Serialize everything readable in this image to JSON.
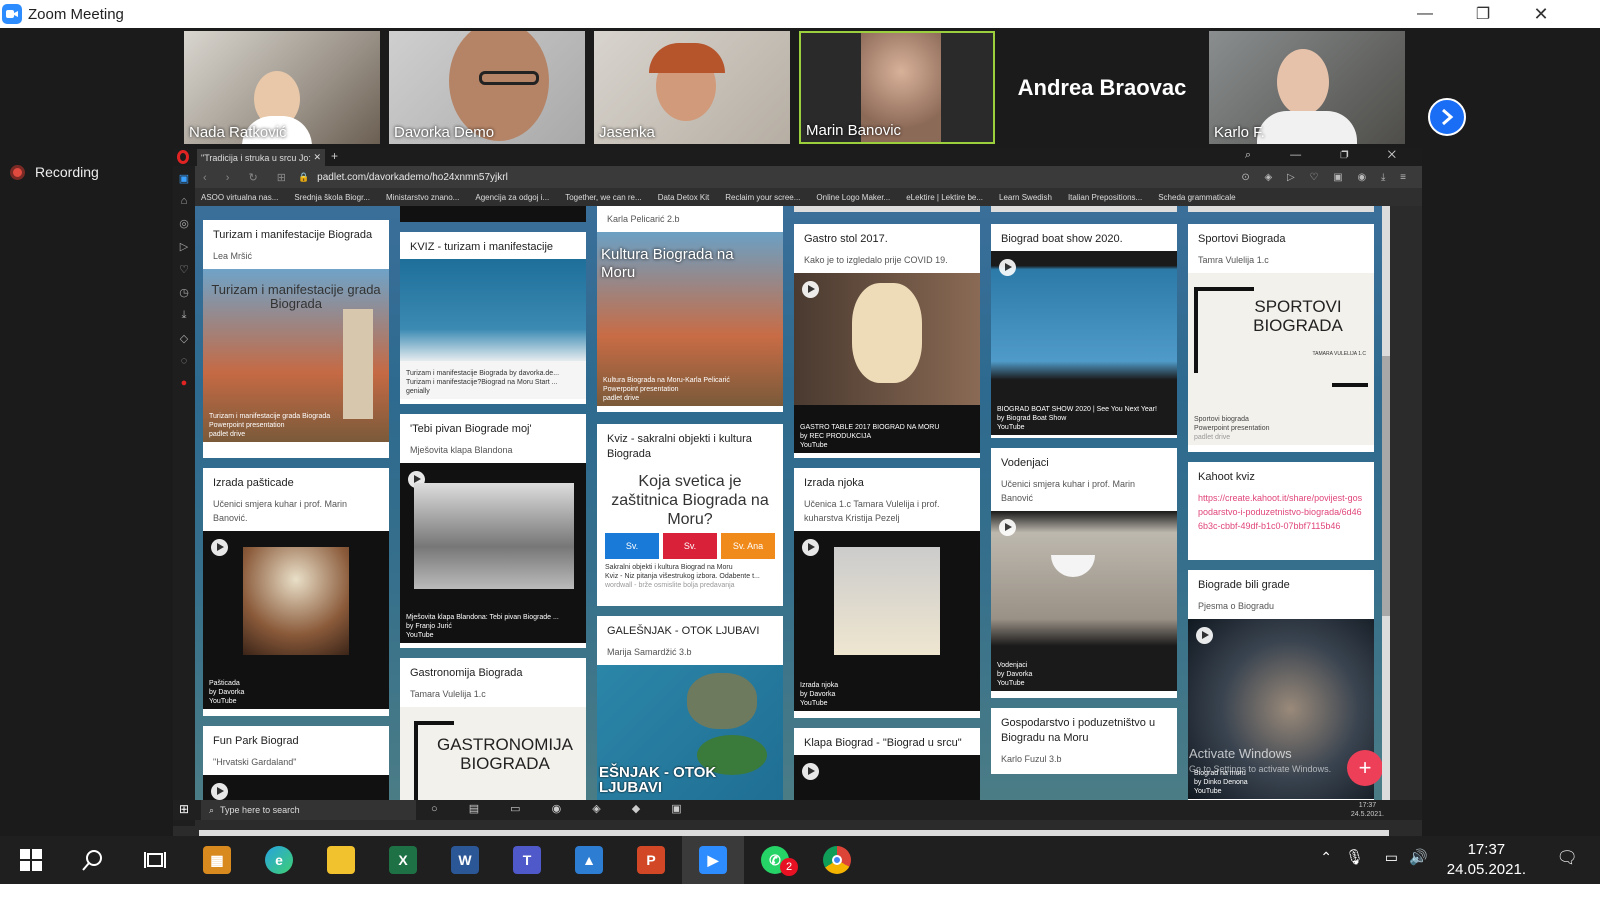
{
  "window": {
    "title": "Zoom Meeting",
    "minimize": "—",
    "maximize": "❐",
    "close": "✕"
  },
  "participants": [
    {
      "name": "Nada Ratković"
    },
    {
      "name": "Davorka Demo"
    },
    {
      "name": "Jasenka"
    },
    {
      "name": "Marin Banovic"
    },
    {
      "name": "Andrea Braovac"
    },
    {
      "name": "Karlo F."
    }
  ],
  "recording": {
    "label": "Recording"
  },
  "browser": {
    "tab_title": "\"Tradicija i struka u srcu Jo:",
    "url": "padlet.com/davorkademo/ho24xnmn57yjkrl",
    "bookmarks": [
      "ASOO virtualna nas...",
      "Srednja škola Biogr...",
      "Ministarstvo znano...",
      "Agencija za odgoj i...",
      "Together, we can re...",
      "Data Detox Kit",
      "Reclaim your scree...",
      "Online Logo Maker...",
      "eLektire | Lektire be...",
      "Learn Swedish",
      "Italian Prepositions...",
      "Scheda grammaticale"
    ]
  },
  "padlet": {
    "col1": [
      {
        "title": "Turizam i manifestacije Biograda",
        "sub": "Lea Mršić",
        "overlay": "Turizam i manifestacije grada Biograda",
        "cap1": "Turizam i manifestacije grada Biograda",
        "cap2": "Powerpoint presentation",
        "cap3": "padlet drive"
      },
      {
        "title": "Izrada pašticade",
        "sub": "Učenici smjera kuhar i prof. Marin Banović.",
        "cap1": "Pašticada",
        "cap2": "by Davorka",
        "cap3": "YouTube"
      },
      {
        "title": "Fun Park Biograd",
        "sub": "\"Hrvatski Gardaland\""
      }
    ],
    "col2": [
      {
        "title": "KVIZ - turizam i manifestacije",
        "cap1": "Turizam i manifestacije Biograda by davorka.de...",
        "cap2": "Turizam i manifestacije?Biograd na Moru Start ...",
        "cap3": "genially"
      },
      {
        "title": "'Tebi pivan Biograde moj'",
        "sub": "Mješovita klapa Blandona",
        "cap1": "Mješovita klapa Blandona: Tebi pivan Biograde ...",
        "cap2": "by Franjo Jurić",
        "cap3": "YouTube"
      },
      {
        "title": "Gastronomija Biograda",
        "sub": "Tamara Vulelija 1.c",
        "overlay": "GASTRONOMIJA BIOGRADA"
      }
    ],
    "col3": [
      {
        "sub": "Karla Pelicarić 2.b",
        "overlay": "Kultura Biograda na Moru",
        "cap1": "Kultura Biograda na Moru-Karla Pelicarić",
        "cap2": "Powerpoint presentation",
        "cap3": "padlet drive"
      },
      {
        "title": "Kviz - sakralni objekti i kultura Biograda",
        "overlay": "Koja svetica je zaštitnica Biograda na Moru?",
        "opt1": "Sv.",
        "opt2": "Sv.",
        "opt3": "Sv. Ana",
        "cap1": "Sakralni objekti i kultura Biograd na Moru",
        "cap2": "Kviz - Niz pitanja višestrukog izbora. Odabente t...",
        "cap3": "wordwall - brže osmislite bolja predavanja"
      },
      {
        "title": "GALEŠNJAK - OTOK LJUBAVI",
        "sub": "Marija Samardžić 3.b",
        "overlay": "EŠNJAK - OTOK LJUBAVI"
      }
    ],
    "col4": [
      {
        "title": "Gastro stol 2017.",
        "sub": "Kako je to izgledalo prije COVID 19.",
        "cap1": "GASTRO TABLE 2017 BIOGRAD NA MORU",
        "cap2": "by REC PRODUKCIJA",
        "cap3": "YouTube"
      },
      {
        "title": "Izrada njoka",
        "sub": "Učenica 1.c Tamara Vulelija i prof. kuharstva Kristija Pezelj",
        "cap1": "Izrada njoka",
        "cap2": "by Davorka",
        "cap3": "YouTube"
      },
      {
        "title": "Klapa Biograd - \"Biograd u srcu\""
      }
    ],
    "col5": [
      {
        "title": "Biograd boat show 2020.",
        "cap1": "BIOGRAD BOAT SHOW 2020 | See You Next Year!",
        "cap2": "by Biograd Boat Show",
        "cap3": "YouTube"
      },
      {
        "title": "Vodenjaci",
        "sub": "Učenici smjera kuhar i prof. Marin Banović",
        "cap1": "Vodenjaci",
        "cap2": "by Davorka",
        "cap3": "YouTube"
      },
      {
        "title": "Gospodarstvo i poduzetništvo u Biogradu na Moru",
        "sub": "Karlo Fuzul 3.b"
      }
    ],
    "col6": [
      {
        "title": "Sportovi Biograda",
        "sub": "Tamra Vulelija 1.c",
        "overlay": "SPORTOVI BIOGRADA",
        "small": "TAMARA VULELIJA 1.C",
        "cap1": "Sportovi biograda",
        "cap2": "Powerpoint presentation",
        "cap3": "padlet drive"
      },
      {
        "title": "Kahoot kviz",
        "link": "https://create.kahoot.it/share/povijest-gospodarstvo-i-poduzetnistvo-biograda/6d466b3c-cbbf-49df-b1c0-07bbf7115b46"
      },
      {
        "title": "Biograde bili grade",
        "sub": "Pjesma o Biogradu",
        "cap1": "Biograd na moru",
        "cap2": "by Dinko Denona",
        "cap3": "YouTube"
      }
    ],
    "watermark1": "Activate Windows",
    "watermark2": "Go to Settings to activate Windows.",
    "fab": "+"
  },
  "inner_taskbar": {
    "search": "Type here to search",
    "time": "17:37",
    "date": "24.5.2021."
  },
  "taskbar": {
    "time": "17:37",
    "date": "24.05.2021.",
    "whatsapp_badge": "2"
  }
}
